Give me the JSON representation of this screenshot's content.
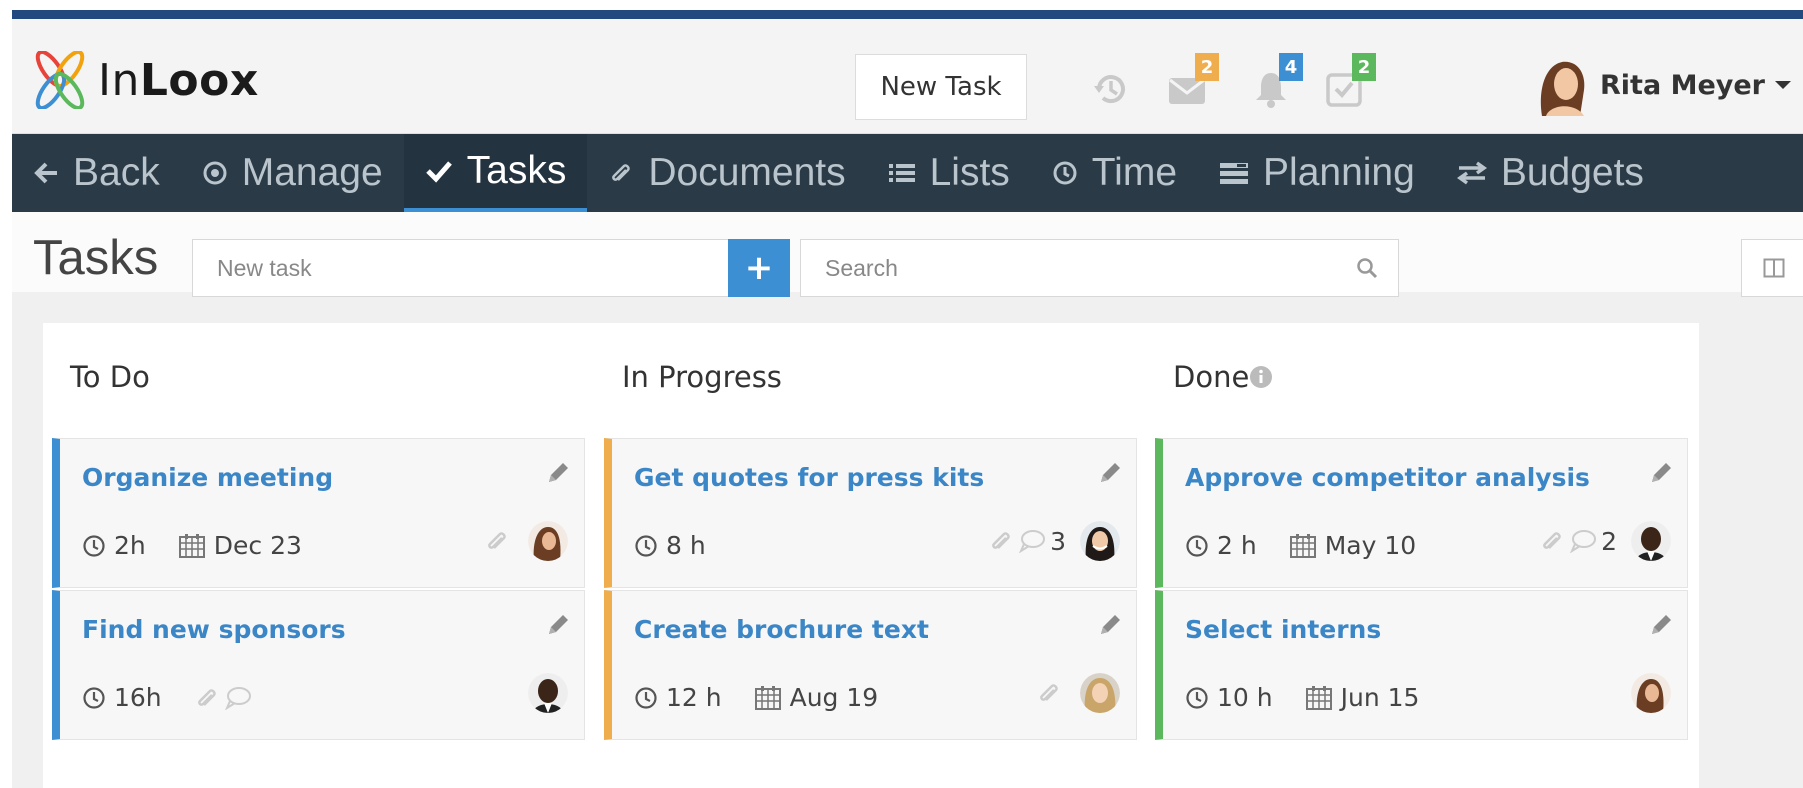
{
  "header": {
    "logo_text_light": "In",
    "logo_text_bold": "Loox",
    "new_task_label": "New Task",
    "mail_badge": "2",
    "notifications_badge": "4",
    "approvals_badge": "2",
    "user_name": "Rita Meyer",
    "colors": {
      "mail_badge": "#f0ad4e",
      "notifications_badge": "#3c8fd2",
      "approvals_badge": "#5cb85c"
    }
  },
  "nav": {
    "items": [
      {
        "label": "Back",
        "icon": "arrow-left-icon"
      },
      {
        "label": "Manage",
        "icon": "target-icon"
      },
      {
        "label": "Tasks",
        "icon": "check-icon",
        "active": true
      },
      {
        "label": "Documents",
        "icon": "paperclip-icon"
      },
      {
        "label": "Lists",
        "icon": "list-icon"
      },
      {
        "label": "Time",
        "icon": "clock-icon"
      },
      {
        "label": "Planning",
        "icon": "planning-icon"
      },
      {
        "label": "Budgets",
        "icon": "exchange-icon"
      }
    ]
  },
  "toolbar": {
    "title": "Tasks",
    "new_task_placeholder": "New task",
    "add_label": "+",
    "search_placeholder": "Search"
  },
  "board": {
    "columns": [
      {
        "title": "To Do",
        "color": "#3c8fd2",
        "cards": [
          {
            "title": "Organize meeting",
            "duration": "2h",
            "date": "Dec  23",
            "attachment": true,
            "comments": false,
            "comment_count": "",
            "avatar": "woman-brunette"
          },
          {
            "title": "Find new sponsors",
            "duration": "16h",
            "date": "",
            "attachment": true,
            "comments": true,
            "comment_count": "",
            "avatar": "man-dark"
          }
        ]
      },
      {
        "title": "In Progress",
        "color": "#f0ad4e",
        "cards": [
          {
            "title": "Get quotes for press kits",
            "duration": "8 h",
            "date": "",
            "attachment": true,
            "comments": true,
            "comment_count": "3",
            "avatar": "woman-dark-hair"
          },
          {
            "title": "Create brochure text",
            "duration": "12 h",
            "date": "Aug  19",
            "attachment": true,
            "comments": false,
            "comment_count": "",
            "avatar": "woman-blonde"
          }
        ]
      },
      {
        "title": "Done",
        "info_icon": "info-icon",
        "color": "#5cb85c",
        "cards": [
          {
            "title": "Approve competitor analysis",
            "duration": "2 h",
            "date": "May 10",
            "attachment": true,
            "comments": true,
            "comment_count": "2",
            "avatar": "man-dark"
          },
          {
            "title": "Select interns",
            "duration": "10 h",
            "date": "Jun  15",
            "attachment": false,
            "comments": false,
            "comment_count": "",
            "avatar": "woman-brunette"
          }
        ]
      }
    ]
  }
}
